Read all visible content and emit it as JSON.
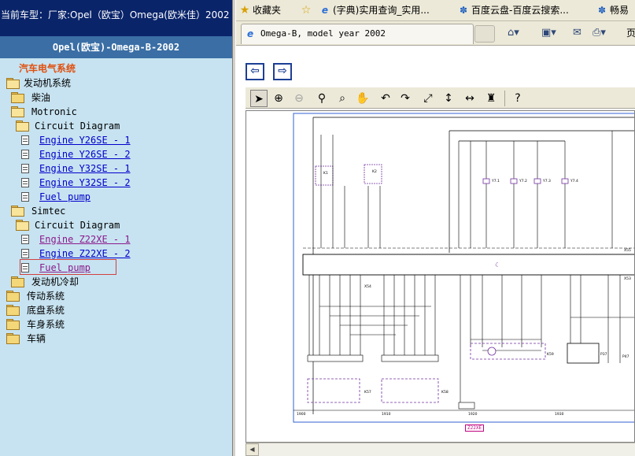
{
  "left_panel": {
    "car_info": "当前车型：厂家:Opel（欧宝）Omega(欧米佳）2002",
    "model_title": "Opel(欧宝)-Omega-B-2002",
    "tree": {
      "root": "汽车电气系统",
      "engine_system": "发动机系统",
      "diesel": "柴油",
      "motronic": "Motronic",
      "motronic_circuit": "Circuit Diagram",
      "motronic_links": [
        "Engine Y26SE - 1",
        "Engine Y26SE - 2",
        "Engine Y32SE - 1",
        "Engine Y32SE - 2",
        "Fuel pump"
      ],
      "simtec": "Simtec",
      "simtec_circuit": "Circuit Diagram",
      "simtec_links": [
        "Engine Z22XE - 1",
        "Engine Z22XE - 2",
        "Fuel pump"
      ],
      "engine_cooling": "发动机冷却",
      "transmission": "传动系统",
      "chassis": "底盘系统",
      "body": "车身系统",
      "vehicle": "车辆"
    }
  },
  "browser": {
    "favorites_label": "收藏夹",
    "favorites": [
      "(字典)实用查询_实用...",
      "百度云盘-百度云搜索...",
      "畅易"
    ],
    "tab_title": "Omega-B, model year 2002",
    "page_menu": "页"
  },
  "diagram": {
    "component_labels": [
      "K1",
      "K2",
      "Y7.1",
      "Y7.2",
      "Y7.3",
      "Y7.4",
      "X55",
      "X54",
      "X53",
      "K57",
      "K58",
      "K59",
      "P37",
      "P47"
    ],
    "grid_numbers": [
      "1900",
      "1910",
      "1920",
      "1930"
    ],
    "scroll_label": "Z22XE"
  }
}
